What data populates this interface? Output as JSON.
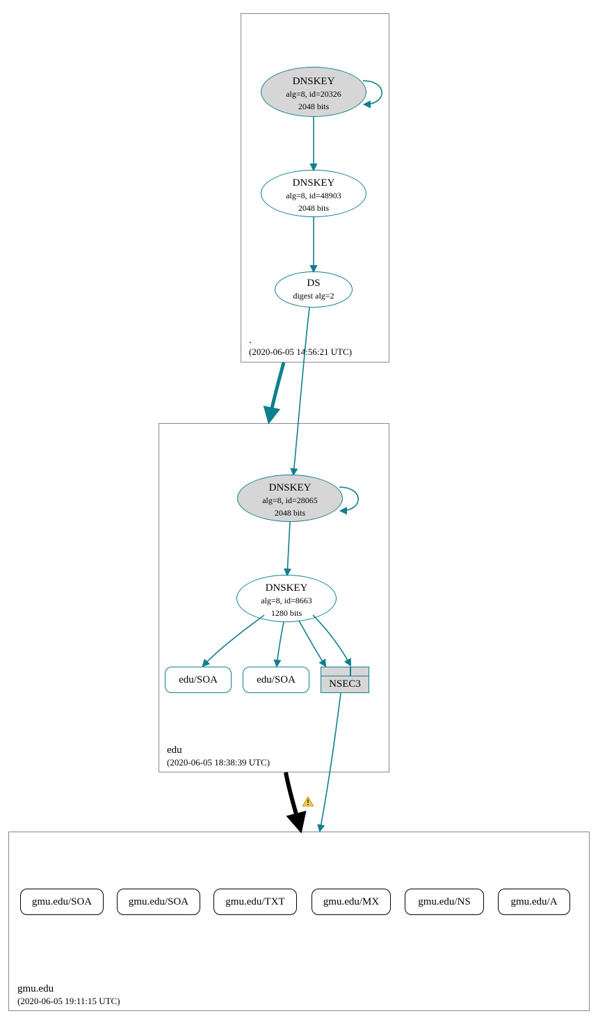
{
  "zones": {
    "root": {
      "label": ".",
      "time": "(2020-06-05 14:56:21 UTC)"
    },
    "edu": {
      "label": "edu",
      "time": "(2020-06-05 18:38:39 UTC)"
    },
    "gmu": {
      "label": "gmu.edu",
      "time": "(2020-06-05 19:11:15 UTC)"
    }
  },
  "nodes": {
    "root_ksk": {
      "title": "DNSKEY",
      "l2": "alg=8, id=20326",
      "l3": "2048 bits"
    },
    "root_zsk": {
      "title": "DNSKEY",
      "l2": "alg=8, id=48903",
      "l3": "2048 bits"
    },
    "root_ds": {
      "title": "DS",
      "l2": "digest alg=2"
    },
    "edu_ksk": {
      "title": "DNSKEY",
      "l2": "alg=8, id=28065",
      "l3": "2048 bits"
    },
    "edu_zsk": {
      "title": "DNSKEY",
      "l2": "alg=8, id=8663",
      "l3": "1280 bits"
    },
    "edu_soa1": "edu/SOA",
    "edu_soa2": "edu/SOA",
    "nsec3": "NSEC3",
    "gmu_soa1": "gmu.edu/SOA",
    "gmu_soa2": "gmu.edu/SOA",
    "gmu_txt": "gmu.edu/TXT",
    "gmu_mx": "gmu.edu/MX",
    "gmu_ns": "gmu.edu/NS",
    "gmu_a": "gmu.edu/A"
  },
  "colors": {
    "teal": "#0e7f8f",
    "grey": "#d6d6d6"
  }
}
